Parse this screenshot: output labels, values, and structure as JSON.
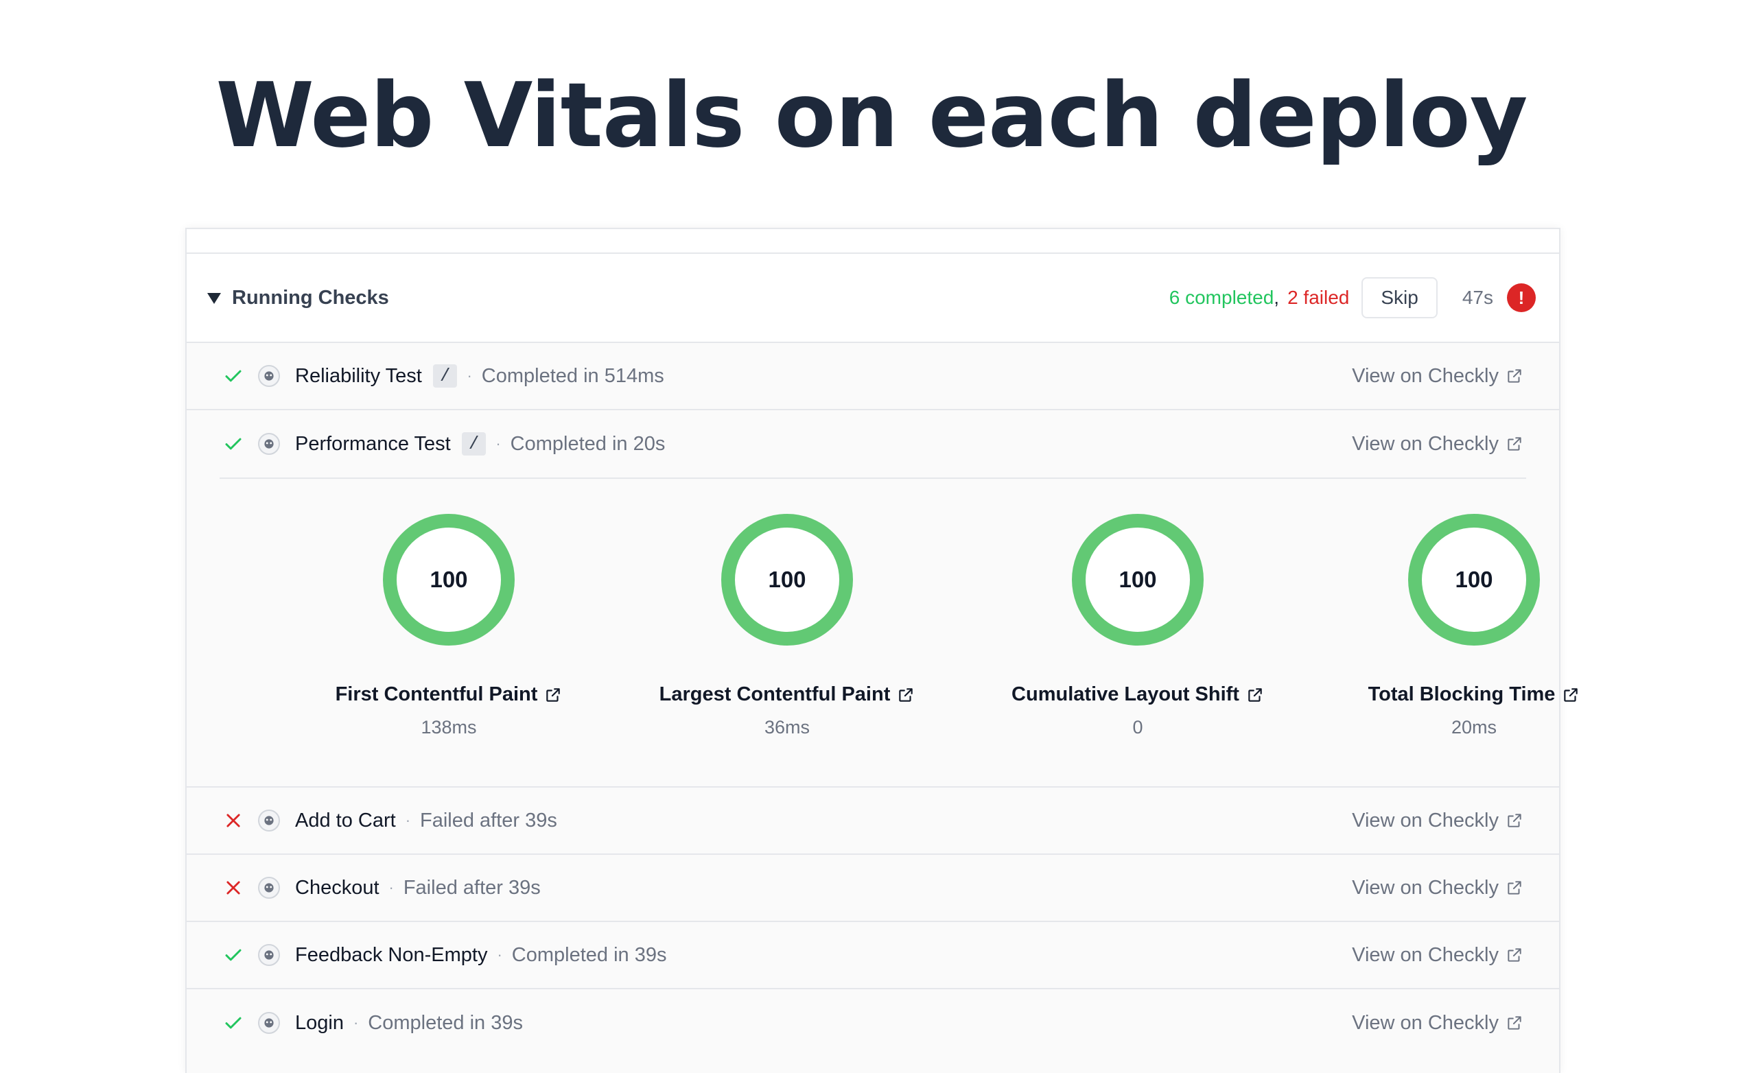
{
  "hero": {
    "title": "Web Vitals on each deploy"
  },
  "header": {
    "title": "Running Checks",
    "completed": "6 completed",
    "separator": ",",
    "failed": "2 failed",
    "skip_label": "Skip",
    "elapsed": "47s",
    "alert_glyph": "!"
  },
  "link_label": "View on Checkly",
  "checks": [
    {
      "name": "Reliability Test",
      "path": "/",
      "status": "Completed in 514ms",
      "state": "passed"
    },
    {
      "name": "Performance Test",
      "path": "/",
      "status": "Completed in 20s",
      "state": "passed"
    },
    {
      "name": "Add to Cart",
      "status": "Failed after 39s",
      "state": "failed"
    },
    {
      "name": "Checkout",
      "status": "Failed after 39s",
      "state": "failed"
    },
    {
      "name": "Feedback Non-Empty",
      "status": "Completed in 39s",
      "state": "passed"
    },
    {
      "name": "Login",
      "status": "Completed in 39s",
      "state": "passed"
    }
  ],
  "metrics": [
    {
      "score": "100",
      "label": "First Contentful Paint",
      "value": "138ms"
    },
    {
      "score": "100",
      "label": "Largest Contentful Paint",
      "value": "36ms"
    },
    {
      "score": "100",
      "label": "Cumulative Layout Shift",
      "value": "0"
    },
    {
      "score": "100",
      "label": "Total Blocking Time",
      "value": "20ms"
    }
  ],
  "colors": {
    "pass": "#22c55e",
    "fail": "#dc2626",
    "ring": "#62c974"
  },
  "icons": {
    "passed": "check-icon",
    "failed": "x-icon",
    "link": "external-link-icon",
    "avatar": "avatar-icon"
  }
}
